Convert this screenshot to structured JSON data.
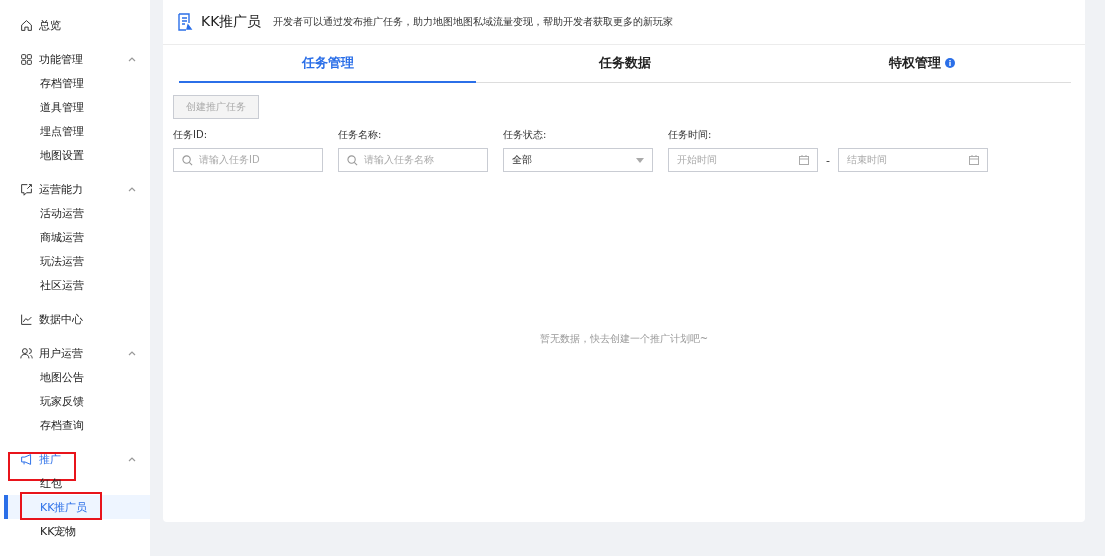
{
  "sidebar": {
    "items": [
      {
        "kind": "link",
        "label": "总览",
        "highlighted": false
      },
      {
        "kind": "group",
        "label": "功能管理",
        "expanded": true,
        "highlighted": false,
        "active": false,
        "children": [
          {
            "label": "存档管理",
            "selected": false,
            "highlighted": false
          },
          {
            "label": "道具管理",
            "selected": false,
            "highlighted": false
          },
          {
            "label": "埋点管理",
            "selected": false,
            "highlighted": false
          },
          {
            "label": "地图设置",
            "selected": false,
            "highlighted": false
          }
        ]
      },
      {
        "kind": "group",
        "label": "运营能力",
        "expanded": true,
        "highlighted": false,
        "active": false,
        "children": [
          {
            "label": "活动运营",
            "selected": false,
            "highlighted": false
          },
          {
            "label": "商城运营",
            "selected": false,
            "highlighted": false
          },
          {
            "label": "玩法运营",
            "selected": false,
            "highlighted": false
          },
          {
            "label": "社区运营",
            "selected": false,
            "highlighted": false
          }
        ]
      },
      {
        "kind": "link",
        "label": "数据中心",
        "highlighted": false
      },
      {
        "kind": "group",
        "label": "用户运营",
        "expanded": true,
        "highlighted": false,
        "active": false,
        "children": [
          {
            "label": "地图公告",
            "selected": false,
            "highlighted": false
          },
          {
            "label": "玩家反馈",
            "selected": false,
            "highlighted": false
          },
          {
            "label": "存档查询",
            "selected": false,
            "highlighted": false
          }
        ]
      },
      {
        "kind": "group",
        "label": "推广",
        "expanded": true,
        "highlighted": true,
        "active": true,
        "children": [
          {
            "label": "红包",
            "selected": false,
            "highlighted": false
          },
          {
            "label": "KK推广员",
            "selected": true,
            "highlighted": true
          },
          {
            "label": "KK宠物",
            "selected": false,
            "highlighted": false
          }
        ]
      }
    ]
  },
  "header": {
    "title": "KK推广员",
    "description": "开发者可以通过发布推广任务，助力地图地图私域流量变现，帮助开发者获取更多的新玩家"
  },
  "tabs": [
    {
      "label": "任务管理",
      "selected": true,
      "info": false
    },
    {
      "label": "任务数据",
      "selected": false,
      "info": false
    },
    {
      "label": "特权管理",
      "selected": false,
      "info": true
    }
  ],
  "create_button": {
    "label": "创建推广任务",
    "disabled": true
  },
  "filters": [
    {
      "kind": "search",
      "label": "任务ID:",
      "placeholder": "请输入任务ID"
    },
    {
      "kind": "search",
      "label": "任务名称:",
      "placeholder": "请输入任务名称"
    },
    {
      "kind": "select",
      "label": "任务状态:",
      "value": "全部"
    },
    {
      "kind": "daterange",
      "label": "任务时间:",
      "start_placeholder": "开始时间",
      "separator": "-",
      "end_placeholder": "结束时间"
    }
  ],
  "empty_message": "暂无数据，快去创建一个推广计划吧~"
}
